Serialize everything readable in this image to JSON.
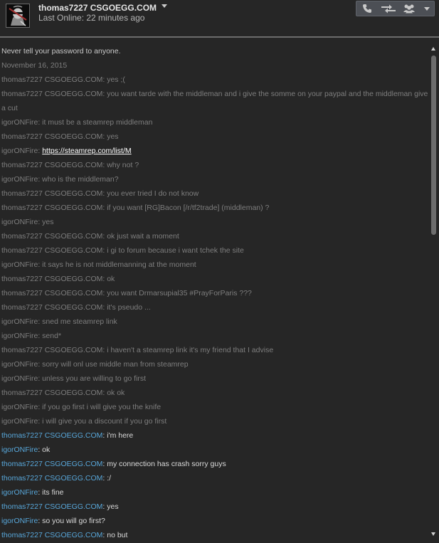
{
  "header": {
    "friend_name": "thomas7227 CSGOEGG.COM",
    "status": "Last Online: 22 minutes ago",
    "avatar_icon": "ninja-avatar",
    "toolbar_icons": [
      "phone-icon",
      "trade-icon",
      "friends-icon",
      "chevron-down-icon"
    ]
  },
  "chat": {
    "notice": "Never tell your password to anyone.",
    "date": "November 16, 2015",
    "messages": [
      {
        "text": "thomas7227 CSGOEGG.COM: yes ;("
      },
      {
        "text": "thomas7227 CSGOEGG.COM: you want tarde with the middleman and i give the somme on your paypal and the middleman give a cut"
      },
      {
        "text": "igorONFire: it must be a steamrep middleman"
      },
      {
        "text": "thomas7227 CSGOEGG.COM: yes"
      },
      {
        "prefix": "igorONFire: ",
        "link": "https://steamrep.com/list/M"
      },
      {
        "text": "thomas7227 CSGOEGG.COM: why not ?"
      },
      {
        "text": "igorONFire: who is the middleman?"
      },
      {
        "text": "thomas7227 CSGOEGG.COM: you ever tried I do not know"
      },
      {
        "text": "thomas7227 CSGOEGG.COM: if you want [RG]Bacon [/r/tf2trade] (middleman) ?"
      },
      {
        "text": "igorONFire: yes"
      },
      {
        "text": "thomas7227 CSGOEGG.COM: ok just wait a moment"
      },
      {
        "text": "thomas7227 CSGOEGG.COM: i gi to forum because i want tchek the site"
      },
      {
        "text": "igorONFire: it says he is not middlemanning at the moment"
      },
      {
        "text": "thomas7227 CSGOEGG.COM: ok"
      },
      {
        "text": "thomas7227 CSGOEGG.COM: you want Drmarsupial35 #PrayForParis ???"
      },
      {
        "text": "thomas7227 CSGOEGG.COM: it's pseudo ..."
      },
      {
        "text": "igorONFire: sned me steamrep link"
      },
      {
        "text": "igorONFire: send*"
      },
      {
        "text": "thomas7227 CSGOEGG.COM: i haven't a steamrep link it's my friend that I advise"
      },
      {
        "text": "igorONFire: sorry  will onl use middle man from steamrep"
      },
      {
        "text": "igorONFire: unless you are willing to go first"
      },
      {
        "text": "thomas7227 CSGOEGG.COM: ok ok"
      },
      {
        "text": "igorONFire: if you go first i will give you the knife"
      },
      {
        "text": "igorONFire: i will give you a discount if you go first"
      },
      {
        "sender": "thomas7227 CSGOEGG.COM",
        "body": ": i'm here"
      },
      {
        "sender": "igorONFire",
        "body": ": ok"
      },
      {
        "sender": "thomas7227 CSGOEGG.COM",
        "body": ": my connection has crash sorry guys"
      },
      {
        "sender": "thomas7227 CSGOEGG.COM",
        "body": ": :/"
      },
      {
        "sender": "igorONFire",
        "body": ": its fine"
      },
      {
        "sender": "thomas7227 CSGOEGG.COM",
        "body": ": yes"
      },
      {
        "sender": "igorONFire",
        "body": ": so you will go first?"
      },
      {
        "sender": "thomas7227 CSGOEGG.COM",
        "body": ": no but"
      }
    ]
  },
  "colors": {
    "background": "#262626",
    "old_message": "#7e7e7e",
    "new_message": "#d9d9d9",
    "sender_blue": "#58a7da",
    "toolbar": "#4c4f55"
  }
}
